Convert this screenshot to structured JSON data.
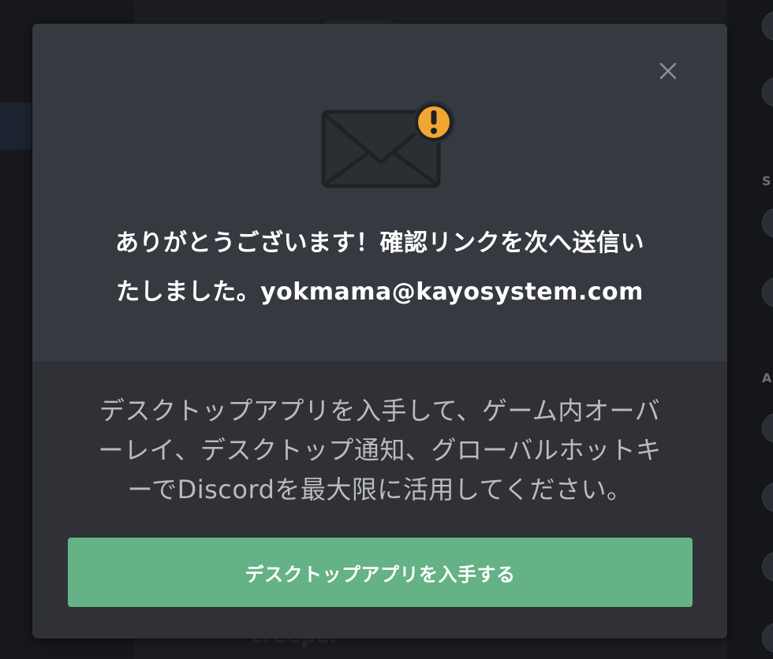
{
  "dialog": {
    "title_line1": "ありがとうございます！確認リンクを次へ送信い",
    "title_line2": "たしました。yokmama@kayosystem.com",
    "description_line1": "デスクトップアプリを入手して、ゲーム内オーバ",
    "description_line2": "ーレイ、デスクトップ通知、グローバルホットキ",
    "description_line3": "ーでDiscordを最大限に活用してください。",
    "download_button_label": "デスクトップアプリを入手する",
    "close_icon": "close-icon",
    "illustration_icon": "envelope-warning-icon"
  },
  "background": {
    "partial_word": "creeper",
    "partial_letters": [
      "S",
      "A"
    ]
  },
  "colors": {
    "backdrop": "#1b1d21",
    "modal_top": "#36393f",
    "modal_bottom": "#2f3136",
    "accent_green": "#64b285",
    "warning_orange": "#f0a732",
    "title_text": "#ffffff",
    "body_text": "#b9bbbe"
  }
}
